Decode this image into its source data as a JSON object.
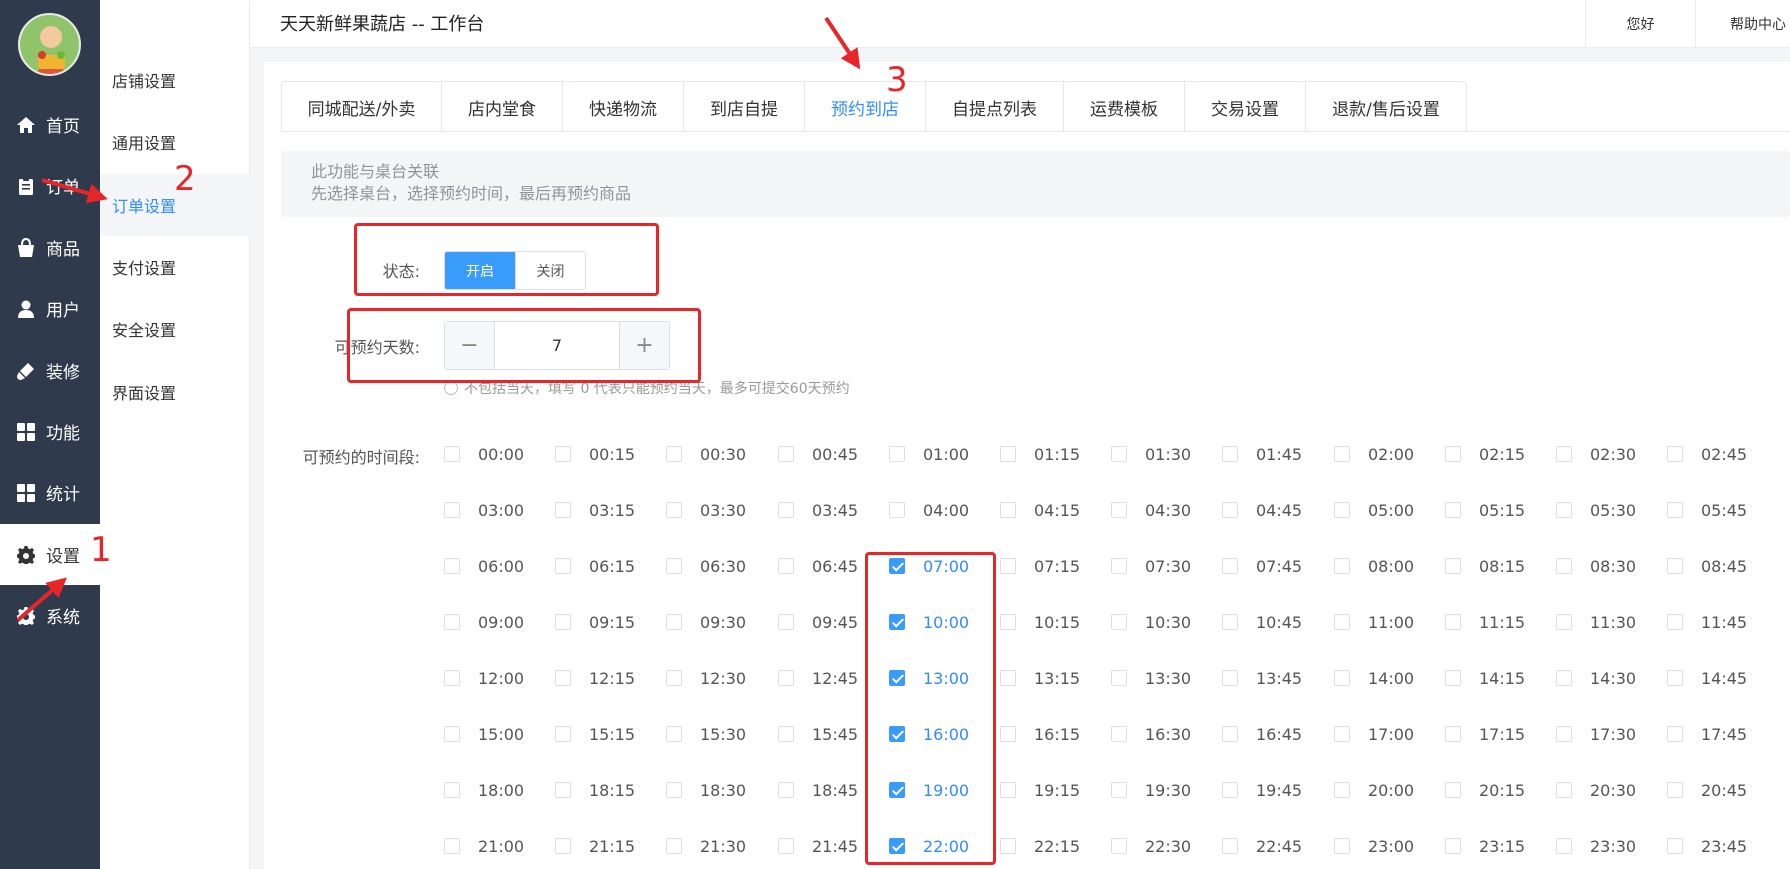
{
  "header": {
    "title": "天天新鲜果蔬店 -- 工作台",
    "greeting": "您好",
    "help": "帮助中心"
  },
  "sidebar": {
    "items": [
      {
        "label": "首页",
        "icon": "home-icon"
      },
      {
        "label": "订单",
        "icon": "clipboard-icon"
      },
      {
        "label": "商品",
        "icon": "bag-icon"
      },
      {
        "label": "用户",
        "icon": "user-icon"
      },
      {
        "label": "装修",
        "icon": "brush-icon"
      },
      {
        "label": "功能",
        "icon": "grid-icon"
      },
      {
        "label": "统计",
        "icon": "grid-icon"
      },
      {
        "label": "设置",
        "icon": "gear-icon"
      },
      {
        "label": "系统",
        "icon": "gear-icon"
      }
    ],
    "active": "设置"
  },
  "submenu": {
    "items": [
      "店铺设置",
      "通用设置",
      "订单设置",
      "支付设置",
      "安全设置",
      "界面设置"
    ],
    "active": "订单设置"
  },
  "tabs": {
    "items": [
      "同城配送/外卖",
      "店内堂食",
      "快递物流",
      "到店自提",
      "预约到店",
      "自提点列表",
      "运费模板",
      "交易设置",
      "退款/售后设置"
    ],
    "active": "预约到店"
  },
  "alert": {
    "line1": "此功能与桌台关联",
    "line2": "先选择桌台，选择预约时间，最后再预约商品"
  },
  "form": {
    "status_label": "状态:",
    "status_on": "开启",
    "status_off": "关闭",
    "status_value": "开启",
    "days_label": "可预约天数:",
    "days_minus": "−",
    "days_value": "7",
    "days_plus": "+",
    "days_hint": "不包括当天，填写 0 代表只能预约当天，最多可提交60天预约",
    "slots_label": "可预约的时间段:"
  },
  "time_slots": [
    [
      "00:00",
      "00:15",
      "00:30",
      "00:45",
      "01:00",
      "01:15",
      "01:30",
      "01:45",
      "02:00",
      "02:15",
      "02:30",
      "02:45"
    ],
    [
      "03:00",
      "03:15",
      "03:30",
      "03:45",
      "04:00",
      "04:15",
      "04:30",
      "04:45",
      "05:00",
      "05:15",
      "05:30",
      "05:45"
    ],
    [
      "06:00",
      "06:15",
      "06:30",
      "06:45",
      "07:00",
      "07:15",
      "07:30",
      "07:45",
      "08:00",
      "08:15",
      "08:30",
      "08:45"
    ],
    [
      "09:00",
      "09:15",
      "09:30",
      "09:45",
      "10:00",
      "10:15",
      "10:30",
      "10:45",
      "11:00",
      "11:15",
      "11:30",
      "11:45"
    ],
    [
      "12:00",
      "12:15",
      "12:30",
      "12:45",
      "13:00",
      "13:15",
      "13:30",
      "13:45",
      "14:00",
      "14:15",
      "14:30",
      "14:45"
    ],
    [
      "15:00",
      "15:15",
      "15:30",
      "15:45",
      "16:00",
      "16:15",
      "16:30",
      "16:45",
      "17:00",
      "17:15",
      "17:30",
      "17:45"
    ],
    [
      "18:00",
      "18:15",
      "18:30",
      "18:45",
      "19:00",
      "19:15",
      "19:30",
      "19:45",
      "20:00",
      "20:15",
      "20:30",
      "20:45"
    ],
    [
      "21:00",
      "21:15",
      "21:30",
      "21:45",
      "22:00",
      "22:15",
      "22:30",
      "22:45",
      "23:00",
      "23:15",
      "23:30",
      "23:45"
    ]
  ],
  "checked_slots": [
    "07:00",
    "10:00",
    "13:00",
    "16:00",
    "19:00",
    "22:00"
  ],
  "annotations": {
    "step1": "1",
    "step2": "2",
    "step3": "3"
  },
  "colors": {
    "sidebar_bg": "#2f3b4c",
    "primary": "#3a9cfa",
    "annotation": "#e8262a"
  }
}
